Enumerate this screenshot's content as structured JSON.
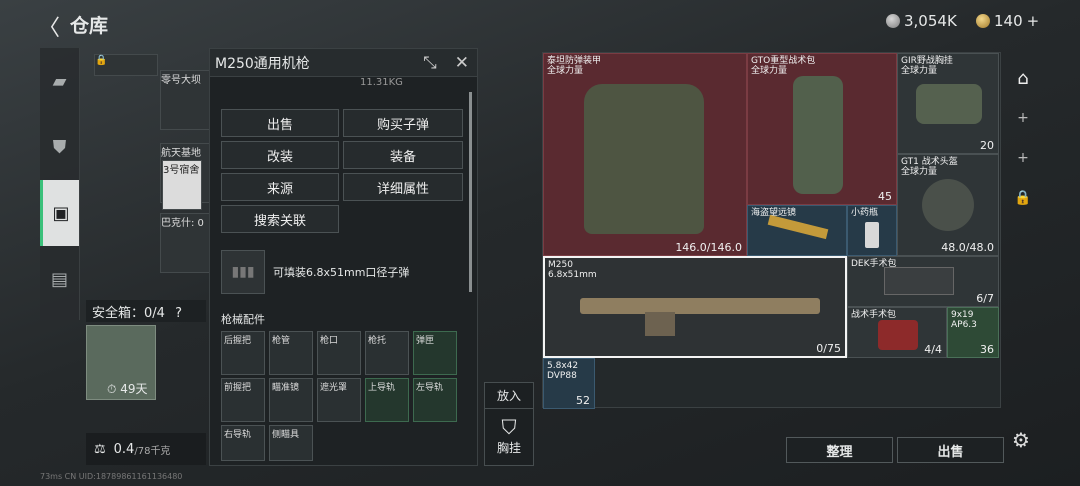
{
  "header": {
    "title": "仓库",
    "back": "〈",
    "silver": "3,054K",
    "gold": "140",
    "plus": "+"
  },
  "stash": {
    "items": [
      {
        "label": "零号大坝"
      },
      {
        "label": "航天基地"
      },
      {
        "label": "3号宿舍"
      },
      {
        "label": "巴克什: 0"
      }
    ]
  },
  "safe": {
    "label": "安全箱：0/4",
    "help": "?",
    "days": "49天"
  },
  "weight": {
    "value": "0.4",
    "max": "/78千克"
  },
  "panel": {
    "title": "M250通用机枪",
    "weight": "11.31KG",
    "buttons": {
      "sell": "出售",
      "buy_ammo": "购买子弹",
      "modify": "改装",
      "equip": "装备",
      "source": "来源",
      "details": "详细属性",
      "search": "搜索关联"
    },
    "ammo_text": "可填装6.8x51mm口径子弹",
    "section": "枪械配件",
    "slots": [
      "后握把",
      "枪管",
      "枪口",
      "枪托",
      "弹匣",
      "前握把",
      "瞄准镜",
      "遮光罩",
      "上导轨",
      "左导轨",
      "右导轨",
      "侧瞄具"
    ]
  },
  "put": {
    "top": "放入",
    "bottom": "胸挂"
  },
  "inventory": {
    "armor": {
      "name": "泰坦防弹装甲",
      "sub": "全球力量",
      "dur": "146.0/146.0"
    },
    "backpack": {
      "name": "GTO重型战术包",
      "sub": "全球力量",
      "count": "45"
    },
    "rig": {
      "name": "GIR野战胸挂",
      "sub": "全球力量",
      "count": "20"
    },
    "helmet": {
      "name": "GT1 战术头盔",
      "sub": "全球力量",
      "dur": "48.0/48.0"
    },
    "scope": {
      "name": "海盗望远镜"
    },
    "pill": {
      "name": "小药瓶"
    },
    "gun": {
      "name": "M250",
      "cal": "6.8x51mm",
      "ammo": "0/75"
    },
    "dek": {
      "name": "DEK手术包",
      "count": "6/7"
    },
    "surg": {
      "name": "战术手术包",
      "count": "4/4"
    },
    "ammo919": {
      "name": "9x19",
      "sub": "AP6.3",
      "count": "36"
    },
    "ammo58": {
      "name": "5.8x42",
      "sub": "DVP88",
      "count": "52"
    }
  },
  "actions": {
    "sort": "整理",
    "sell": "出售"
  },
  "footer": "73ms   CN UID:18789861161136480"
}
